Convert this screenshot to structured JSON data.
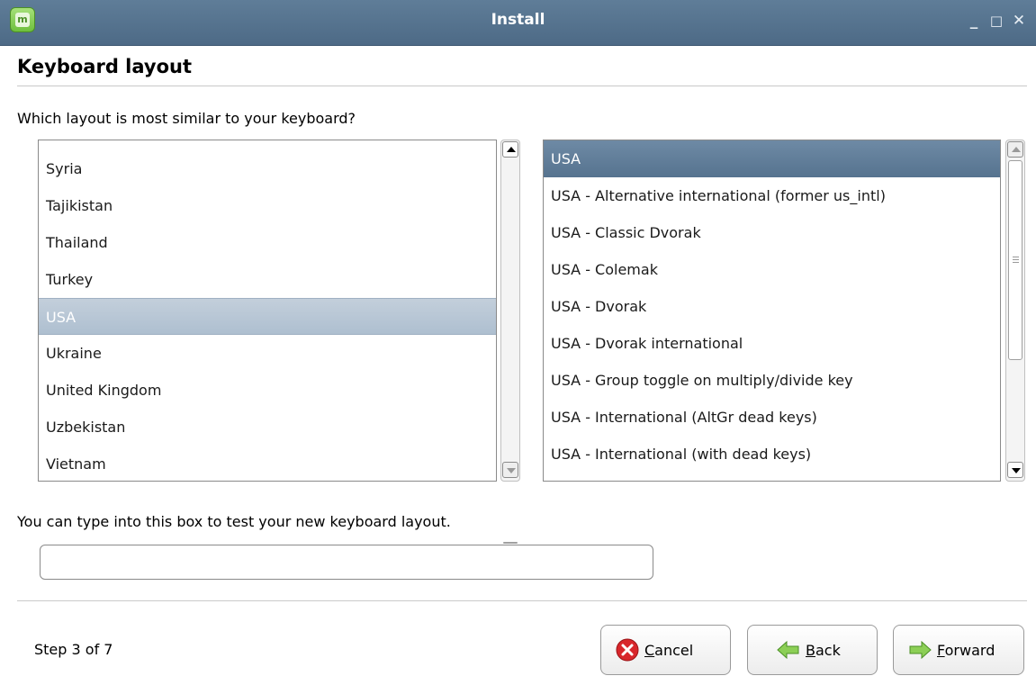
{
  "window": {
    "title": "Install",
    "app_icon": "mint-logo",
    "app_icon_letter": "m",
    "minimize": "_",
    "maximize": "□",
    "close": "✕"
  },
  "page": {
    "heading": "Keyboard layout",
    "question": "Which layout is most similar to your keyboard?",
    "test_label": "You can type into this box to test your new keyboard layout.",
    "test_value": "",
    "step": "Step 3 of 7"
  },
  "countries": {
    "items": [
      "Syria",
      "Tajikistan",
      "Thailand",
      "Turkey",
      "USA",
      "Ukraine",
      "United Kingdom",
      "Uzbekistan",
      "Vietnam"
    ],
    "selected": "USA"
  },
  "variants": {
    "items": [
      "USA",
      "USA - Alternative international (former us_intl)",
      "USA - Classic Dvorak",
      "USA - Colemak",
      "USA - Dvorak",
      "USA - Dvorak international",
      "USA - Group toggle on multiply/divide key",
      "USA - International (AltGr dead keys)",
      "USA - International (with dead keys)"
    ],
    "selected": "USA"
  },
  "buttons": {
    "cancel": {
      "mnemonic": "C",
      "rest": "ancel",
      "icon": "cancel-icon",
      "color": "#d8262b"
    },
    "back": {
      "mnemonic": "B",
      "rest": "ack",
      "icon": "back-arrow-icon",
      "color": "#6fbf3d"
    },
    "forward": {
      "mnemonic": "F",
      "rest": "orward",
      "icon": "forward-arrow-icon",
      "color": "#6fbf3d"
    }
  },
  "colors": {
    "titlebar": "#56738f",
    "selection_active": "#5f7d98",
    "selection_inactive": "#b8c7d6"
  }
}
